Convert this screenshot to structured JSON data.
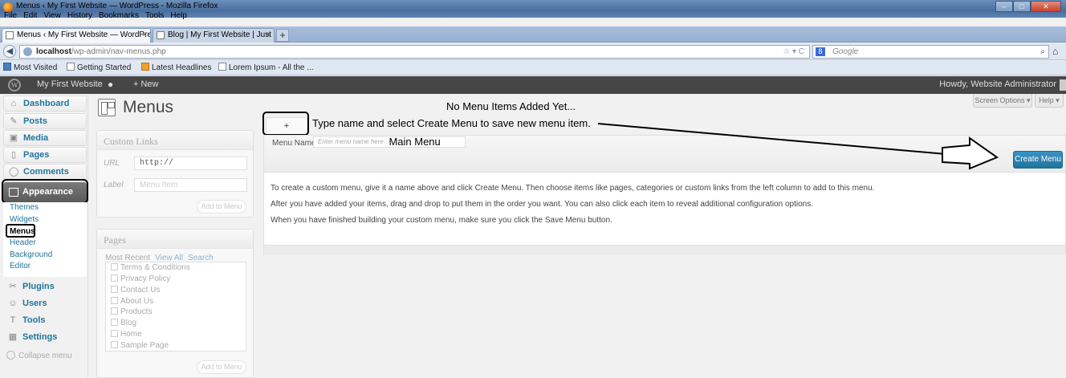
{
  "browser": {
    "window_title": "Menus ‹ My First Website — WordPress - Mozilla Firefox",
    "menu": [
      "File",
      "Edit",
      "View",
      "History",
      "Bookmarks",
      "Tools",
      "Help"
    ],
    "tabs": [
      {
        "label": "Menus ‹ My First Website — WordPress",
        "active": true
      },
      {
        "label": "Blog | My First Website | Just another ...",
        "active": false
      }
    ],
    "new_tab": "+",
    "back_icon": "back-arrow-icon",
    "url_host": "localhost",
    "url_path": "/wp-admin/nav-menus.php",
    "search_engine_badge": "8",
    "search_placeholder": "Google",
    "bookmarks": [
      "Most Visited",
      "Getting Started",
      "Latest Headlines",
      "Lorem Ipsum - All the ..."
    ]
  },
  "admin_bar": {
    "site_name": "My First Website",
    "new_label": "New",
    "howdy": "Howdy, Website Administrator"
  },
  "sidebar": {
    "items": [
      {
        "label": "Dashboard",
        "icon": "dashboard-icon"
      },
      {
        "label": "Posts",
        "icon": "pin-icon"
      },
      {
        "label": "Media",
        "icon": "media-icon"
      },
      {
        "label": "Pages",
        "icon": "page-icon"
      },
      {
        "label": "Comments",
        "icon": "comment-icon"
      },
      {
        "label": "Appearance",
        "icon": "appearance-icon"
      },
      {
        "label": "Plugins",
        "icon": "plugin-icon"
      },
      {
        "label": "Users",
        "icon": "users-icon"
      },
      {
        "label": "Tools",
        "icon": "tools-icon"
      },
      {
        "label": "Settings",
        "icon": "settings-icon"
      }
    ],
    "appearance_sub": [
      "Themes",
      "Widgets",
      "Menus",
      "Header",
      "Background",
      "Editor"
    ],
    "collapse": "Collapse menu"
  },
  "page": {
    "title": "Menus",
    "screen_options": "Screen Options",
    "help": "Help"
  },
  "custom_links": {
    "title": "Custom Links",
    "url_label": "URL",
    "url_value": "http://",
    "label_label": "Label",
    "label_placeholder": "Menu Item",
    "add_button": "Add to Menu"
  },
  "pages_box": {
    "title": "Pages",
    "tab_recent": "Most Recent",
    "tab_all": "View All",
    "tab_search": "Search",
    "items": [
      "Terms & Conditions",
      "Privacy Policy",
      "Contact Us",
      "About Us",
      "Products",
      "Blog",
      "Home",
      "Sample Page"
    ],
    "add_button": "Add to Menu"
  },
  "menu_editor": {
    "no_items_title": "No Menu Items Added Yet...",
    "plus_tab": "+",
    "annotation": "Type name and select Create Menu to save new menu item.",
    "menu_name_label": "Menu Name",
    "menu_name_placeholder": "Enter menu name here",
    "menu_name_value": "Main Menu",
    "create_button": "Create Menu",
    "instructions": [
      "To create a custom menu, give it a name above and click Create Menu. Then choose items like pages, categories or custom links from the left column to add to this menu.",
      "After you have added your items, drag and drop to put them in the order you want. You can also click each item to reveal additional configuration options.",
      "When you have finished building your custom menu, make sure you click the Save Menu button."
    ]
  },
  "colors": {
    "link_blue": "#21759b",
    "admin_bar": "#464646",
    "primary_button": "#21759b"
  }
}
